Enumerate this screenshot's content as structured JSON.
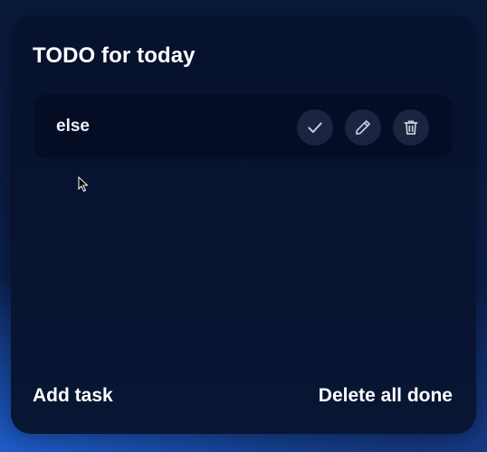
{
  "header": {
    "title": "TODO for today"
  },
  "tasks": [
    {
      "label": "else",
      "done": false,
      "actions": [
        "check-icon",
        "pencil-icon",
        "trash-icon"
      ]
    }
  ],
  "footer": {
    "add_label": "Add task",
    "delete_done_label": "Delete all done"
  },
  "colors": {
    "card": "#07122e",
    "task_bg": "#050d25",
    "action_bg": "#1b2440",
    "icon": "#c8cfdc",
    "text": "#ffffff",
    "accent_glow": "#1e5cc8"
  }
}
